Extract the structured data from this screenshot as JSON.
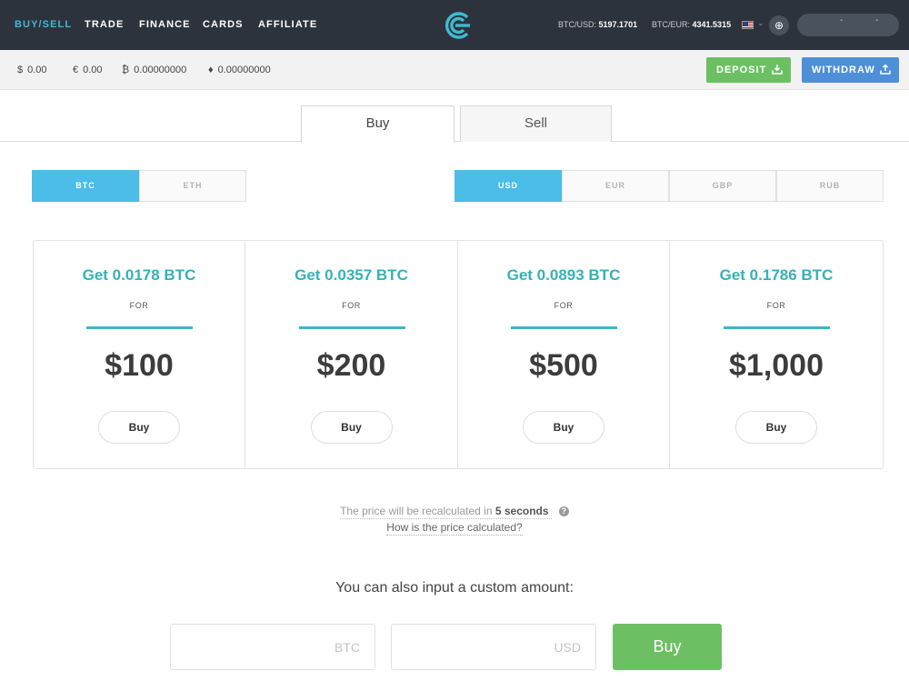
{
  "nav": {
    "links": [
      "BUY/SELL",
      "TRADE",
      "FINANCE",
      "CARDS",
      "AFFILIATE"
    ],
    "tickers": [
      {
        "label": "BTC/USD:",
        "value": "5197.1701"
      },
      {
        "label": "BTC/EUR:",
        "value": "4341.5315"
      }
    ],
    "account_marks": [
      "-",
      "-"
    ]
  },
  "balances": [
    {
      "symbol": "$",
      "amount": "0.00"
    },
    {
      "symbol": "€",
      "amount": "0.00"
    },
    {
      "symbol": "₿",
      "amount": "0.00000000"
    },
    {
      "symbol": "♦",
      "amount": "0.00000000"
    }
  ],
  "actions": {
    "deposit": "DEPOSIT",
    "withdraw": "WITHDRAW"
  },
  "tabs": {
    "buy": "Buy",
    "sell": "Sell"
  },
  "crypto_options": [
    "BTC",
    "ETH"
  ],
  "fiat_options": [
    "USD",
    "EUR",
    "GBP",
    "RUB"
  ],
  "offers": [
    {
      "title": "Get 0.0178 BTC",
      "for": "FOR",
      "price": "$100",
      "button": "Buy"
    },
    {
      "title": "Get 0.0357 BTC",
      "for": "FOR",
      "price": "$200",
      "button": "Buy"
    },
    {
      "title": "Get 0.0893 BTC",
      "for": "FOR",
      "price": "$500",
      "button": "Buy"
    },
    {
      "title": "Get 0.1786 BTC",
      "for": "FOR",
      "price": "$1,000",
      "button": "Buy"
    }
  ],
  "notice": {
    "prefix": "The price will be recalculated in",
    "seconds": "5 seconds",
    "link": "How is the price calculated?"
  },
  "custom": {
    "label": "You can also input a custom amount:",
    "btc_placeholder": "BTC",
    "usd_placeholder": "USD",
    "button": "Buy"
  },
  "colors": {
    "accent": "#3fbad1",
    "green": "#6cc063",
    "blue": "#4f8fd8",
    "toggle_on": "#4bbde8",
    "nav_bg": "#2d333d"
  }
}
